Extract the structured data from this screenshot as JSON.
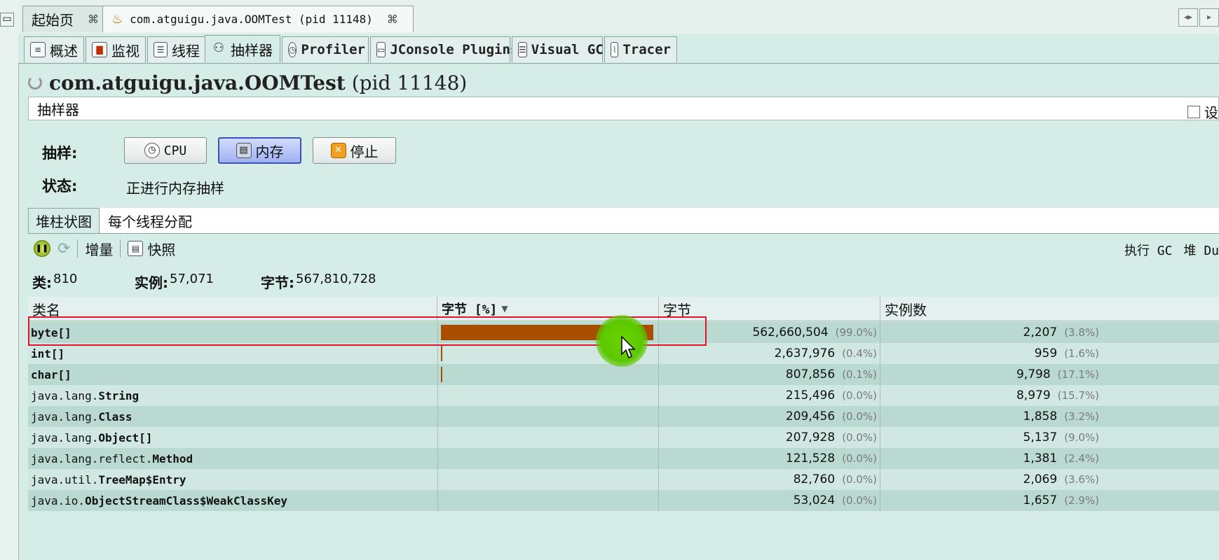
{
  "doc_tabs": [
    {
      "label": "起始页",
      "close": "⌘"
    },
    {
      "label": "com.atguigu.java.OOMTest (pid 11148)",
      "close": "⌘"
    }
  ],
  "tool_tabs": [
    {
      "label": "概述",
      "icon": "overview-icon",
      "glyph": "≡"
    },
    {
      "label": "监视",
      "icon": "monitor-icon",
      "glyph": "▇"
    },
    {
      "label": "线程",
      "icon": "threads-icon",
      "glyph": "☰"
    },
    {
      "label": "抽样器",
      "icon": "sampler-icon",
      "glyph": "⚇"
    },
    {
      "label": "Profiler",
      "icon": "profiler-icon",
      "glyph": "◷"
    },
    {
      "label": "JConsole Plugins",
      "icon": "jconsole-icon",
      "glyph": "▭"
    },
    {
      "label": "Visual GC",
      "icon": "visualgc-icon",
      "glyph": "☰"
    },
    {
      "label": "Tracer",
      "icon": "tracer-icon",
      "glyph": "⌇"
    }
  ],
  "header": {
    "title_main": "com.atguigu.java.OOMTest",
    "title_pid": "(pid 11148)"
  },
  "sampler": {
    "panel_title": "抽样器",
    "settings_label": "设",
    "sample_label": "抽样:",
    "status_label": "状态:",
    "status_value": "正进行内存抽样",
    "buttons": {
      "cpu": "CPU",
      "memory": "内存",
      "stop": "停止"
    }
  },
  "result_tabs": [
    "堆柱状图",
    "每个线程分配"
  ],
  "toolbar": {
    "delta": "增量",
    "snapshot": "快照",
    "gc": "执行 GC",
    "heap": "堆 Du"
  },
  "summary": {
    "classes_label": "类:",
    "classes_value": "810",
    "instances_label": "实例:",
    "instances_value": "57,071",
    "bytes_label": "字节:",
    "bytes_value": "567,810,728"
  },
  "columns": {
    "name": "类名",
    "bytes_pct": "字节 [%]",
    "bytes": "字节",
    "instances": "实例数"
  },
  "rows": [
    {
      "pkg": "",
      "cls": "byte[]",
      "pct_value": 99.0,
      "bytes": "562,660,504",
      "bytes_pct": "(99.0%)",
      "instances": "2,207",
      "inst_pct": "(3.8%)"
    },
    {
      "pkg": "",
      "cls": "int[]",
      "pct_value": 0.4,
      "bytes": "2,637,976",
      "bytes_pct": "(0.4%)",
      "instances": "959",
      "inst_pct": "(1.6%)"
    },
    {
      "pkg": "",
      "cls": "char[]",
      "pct_value": 0.1,
      "bytes": "807,856",
      "bytes_pct": "(0.1%)",
      "instances": "9,798",
      "inst_pct": "(17.1%)"
    },
    {
      "pkg": "java.lang.",
      "cls": "String",
      "pct_value": 0.0,
      "bytes": "215,496",
      "bytes_pct": "(0.0%)",
      "instances": "8,979",
      "inst_pct": "(15.7%)"
    },
    {
      "pkg": "java.lang.",
      "cls": "Class",
      "pct_value": 0.0,
      "bytes": "209,456",
      "bytes_pct": "(0.0%)",
      "instances": "1,858",
      "inst_pct": "(3.2%)"
    },
    {
      "pkg": "java.lang.",
      "cls": "Object[]",
      "pct_value": 0.0,
      "bytes": "207,928",
      "bytes_pct": "(0.0%)",
      "instances": "5,137",
      "inst_pct": "(9.0%)"
    },
    {
      "pkg": "java.lang.reflect.",
      "cls": "Method",
      "pct_value": 0.0,
      "bytes": "121,528",
      "bytes_pct": "(0.0%)",
      "instances": "1,381",
      "inst_pct": "(2.4%)"
    },
    {
      "pkg": "java.util.",
      "cls": "TreeMap$Entry",
      "pct_value": 0.0,
      "bytes": "82,760",
      "bytes_pct": "(0.0%)",
      "instances": "2,069",
      "inst_pct": "(3.6%)"
    },
    {
      "pkg": "java.io.",
      "cls": "ObjectStreamClass$WeakClassKey",
      "pct_value": 0.0,
      "bytes": "53,024",
      "bytes_pct": "(0.0%)",
      "instances": "1,657",
      "inst_pct": "(2.9%)"
    }
  ],
  "colors": {
    "bar": "#a84e00",
    "highlight": "#e0142c",
    "cursor": "#5cc800"
  }
}
